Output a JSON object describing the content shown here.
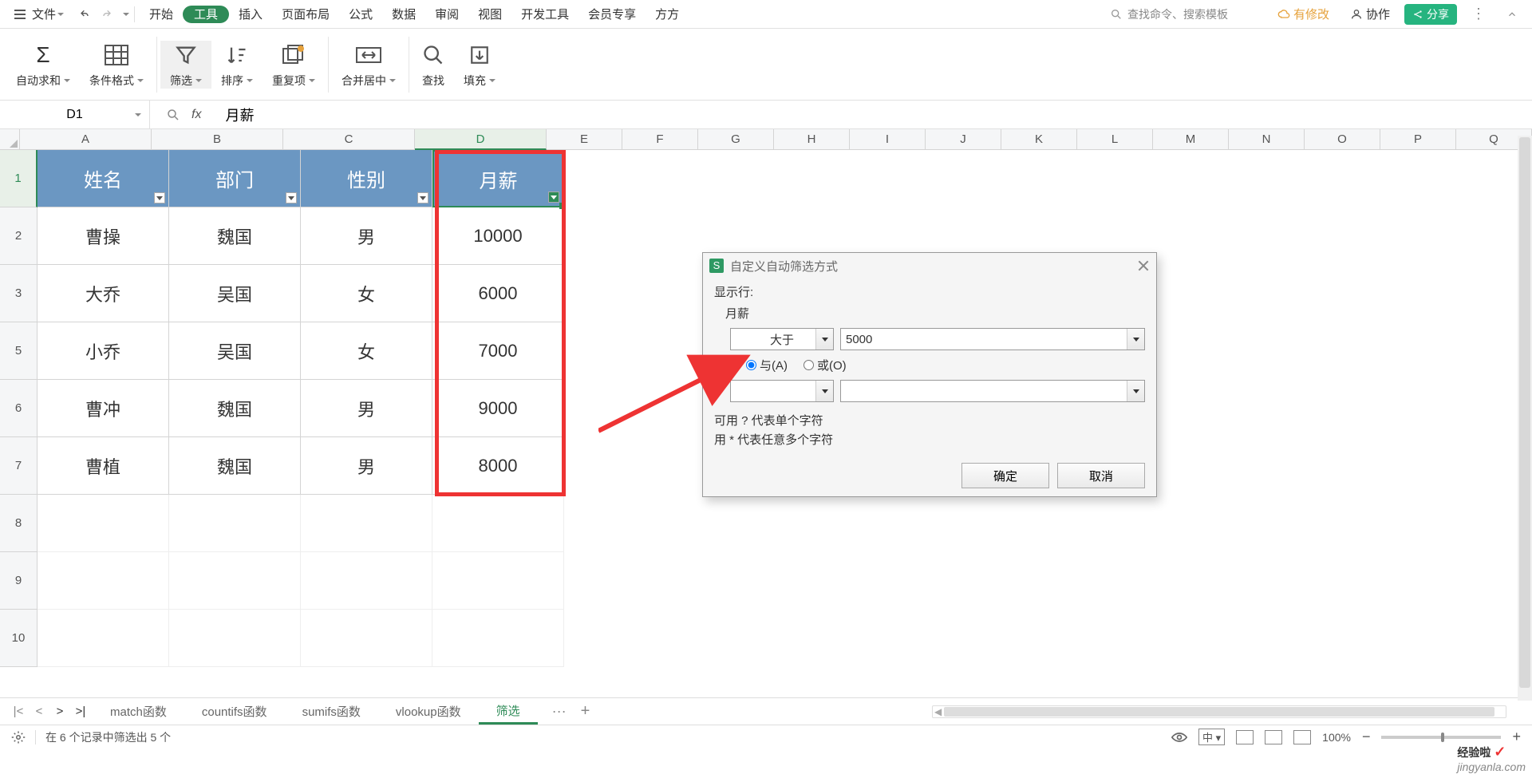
{
  "menubar": {
    "file": "文件",
    "tabs": [
      "开始",
      "工具",
      "插入",
      "页面布局",
      "公式",
      "数据",
      "审阅",
      "视图",
      "开发工具",
      "会员专享",
      "方方"
    ],
    "active_index": 1,
    "search_placeholder": "查找命令、搜索模板",
    "right": {
      "modified": "有修改",
      "collab": "协作",
      "share": "分享"
    }
  },
  "toolbar": {
    "autosum": "自动求和",
    "condfmt": "条件格式",
    "filter": "筛选",
    "sort": "排序",
    "dup": "重复项",
    "merge": "合并居中",
    "find": "查找",
    "fill": "填充"
  },
  "formula_bar": {
    "cell": "D1",
    "fx": "fx",
    "value": "月薪"
  },
  "columns": [
    "A",
    "B",
    "C",
    "D",
    "E",
    "F",
    "G",
    "H",
    "I",
    "J",
    "K",
    "L",
    "M",
    "N",
    "O",
    "P",
    "Q"
  ],
  "rows": [
    "1",
    "2",
    "3",
    "5",
    "6",
    "7",
    "8",
    "9",
    "10"
  ],
  "table": {
    "headers": [
      "姓名",
      "部门",
      "性别",
      "月薪"
    ],
    "data": [
      [
        "曹操",
        "魏国",
        "男",
        "10000"
      ],
      [
        "大乔",
        "吴国",
        "女",
        "6000"
      ],
      [
        "小乔",
        "吴国",
        "女",
        "7000"
      ],
      [
        "曹冲",
        "魏国",
        "男",
        "9000"
      ],
      [
        "曹植",
        "魏国",
        "男",
        "8000"
      ]
    ]
  },
  "dialog": {
    "title": "自定义自动筛选方式",
    "show_rows": "显示行:",
    "field": "月薪",
    "op1": "大于",
    "val1": "5000",
    "and": "与(A)",
    "or": "或(O)",
    "help1": "可用 ? 代表单个字符",
    "help2": "用 * 代表任意多个字符",
    "ok": "确定",
    "cancel": "取消"
  },
  "sheets": {
    "tabs": [
      "match函数",
      "countifs函数",
      "sumifs函数",
      "vlookup函数",
      "筛选"
    ],
    "active_index": 4
  },
  "status": {
    "text": "在 6 个记录中筛选出 5 个",
    "zoom": "100%",
    "lang": "中"
  },
  "watermark": "jingyanla.com",
  "watermark_brand": "经验啦",
  "chart_data": {
    "type": "table",
    "title": "月薪",
    "columns": [
      "姓名",
      "部门",
      "性别",
      "月薪"
    ],
    "rows": [
      {
        "姓名": "曹操",
        "部门": "魏国",
        "性别": "男",
        "月薪": 10000
      },
      {
        "姓名": "大乔",
        "部门": "吴国",
        "性别": "女",
        "月薪": 6000
      },
      {
        "姓名": "小乔",
        "部门": "吴国",
        "性别": "女",
        "月薪": 7000
      },
      {
        "姓名": "曹冲",
        "部门": "魏国",
        "性别": "男",
        "月薪": 9000
      },
      {
        "姓名": "曹植",
        "部门": "魏国",
        "性别": "男",
        "月薪": 8000
      }
    ],
    "filter": {
      "column": "月薪",
      "op": "大于",
      "value": 5000,
      "logic": "与"
    }
  }
}
